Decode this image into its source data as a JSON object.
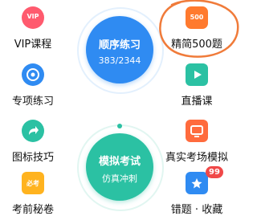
{
  "left": {
    "items": [
      {
        "label": "VIP课程",
        "icon": "vip-icon",
        "icon_text": "VIP"
      },
      {
        "label": "专项练习",
        "icon": "target-icon"
      },
      {
        "label": "图标技巧",
        "icon": "share-arrow-icon"
      },
      {
        "label": "考前秘卷",
        "icon": "secret-paper-icon",
        "icon_text": "必考"
      }
    ]
  },
  "right": {
    "items": [
      {
        "label": "精简500题",
        "icon": "500-questions-icon",
        "icon_text": "500"
      },
      {
        "label": "直播课",
        "icon": "live-play-icon"
      },
      {
        "label": "真实考场模拟",
        "icon": "monitor-icon"
      },
      {
        "label": "错题 · 收藏",
        "icon": "star-book-icon",
        "badge": "99"
      }
    ]
  },
  "center": {
    "sequential": {
      "title": "顺序练习",
      "progress": "383/2344"
    },
    "mock": {
      "title": "模拟考试",
      "subtitle": "仿真冲刺"
    }
  },
  "colors": {
    "blue": "#2f8bf2",
    "teal": "#2bc1a3",
    "orange": "#ff7a2e",
    "annotation_circle": "#f07b3a"
  }
}
